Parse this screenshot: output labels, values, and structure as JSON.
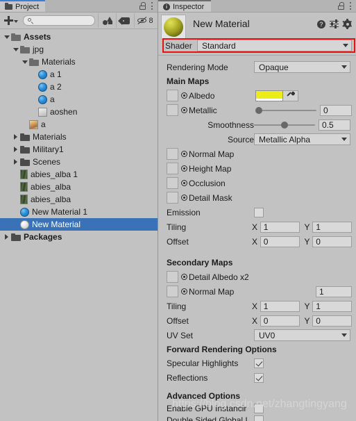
{
  "project": {
    "tab_label": "Project",
    "tab_icon": "folder-icon",
    "lock_icon": "lock-icon",
    "menu_icon": "kebab-menu-icon",
    "toolbar": {
      "add_label": "+",
      "add_icon": "plus-icon",
      "add_caret_icon": "caret-down-icon",
      "search_value": "",
      "search_placeholder": "",
      "search_icon": "search-icon",
      "filter_icon": "shape-filter-icon",
      "tag_icon": "label-tag-icon",
      "visibility_icon": "eye-slash-icon",
      "hidden_count": "8"
    },
    "tree": [
      {
        "label": "Assets",
        "depth": 0,
        "arrow": "down",
        "icon": "folder-open-icon",
        "bold": true,
        "selected": false
      },
      {
        "label": "jpg",
        "depth": 1,
        "arrow": "down",
        "icon": "folder-open-icon",
        "bold": false,
        "selected": false
      },
      {
        "label": "Materials",
        "depth": 2,
        "arrow": "down",
        "icon": "folder-open-icon",
        "bold": false,
        "selected": false
      },
      {
        "label": "a 1",
        "depth": 3,
        "arrow": "none",
        "icon": "material-icon",
        "bold": false,
        "selected": false
      },
      {
        "label": "a 2",
        "depth": 3,
        "arrow": "none",
        "icon": "material-icon",
        "bold": false,
        "selected": false
      },
      {
        "label": "a",
        "depth": 3,
        "arrow": "none",
        "icon": "material-icon",
        "bold": false,
        "selected": false
      },
      {
        "label": "aoshen",
        "depth": 3,
        "arrow": "none",
        "icon": "image-grey-icon",
        "bold": false,
        "selected": false
      },
      {
        "label": "a",
        "depth": 2,
        "arrow": "none",
        "icon": "image-icon",
        "bold": false,
        "selected": false
      },
      {
        "label": "Materials",
        "depth": 1,
        "arrow": "right",
        "icon": "folder-icon",
        "bold": false,
        "selected": false
      },
      {
        "label": "Military1",
        "depth": 1,
        "arrow": "right",
        "icon": "folder-icon",
        "bold": false,
        "selected": false
      },
      {
        "label": "Scenes",
        "depth": 1,
        "arrow": "right",
        "icon": "folder-icon",
        "bold": false,
        "selected": false
      },
      {
        "label": "abies_alba 1",
        "depth": 1,
        "arrow": "none",
        "icon": "tree-asset-icon",
        "bold": false,
        "selected": false
      },
      {
        "label": "abies_alba",
        "depth": 1,
        "arrow": "none",
        "icon": "tree-asset-icon",
        "bold": false,
        "selected": false
      },
      {
        "label": "abies_alba",
        "depth": 1,
        "arrow": "none",
        "icon": "tree-asset-icon",
        "bold": false,
        "selected": false
      },
      {
        "label": "New Material 1",
        "depth": 1,
        "arrow": "none",
        "icon": "material-icon",
        "bold": false,
        "selected": false
      },
      {
        "label": "New Material",
        "depth": 1,
        "arrow": "none",
        "icon": "material-white-icon",
        "bold": false,
        "selected": true
      },
      {
        "label": "Packages",
        "depth": 0,
        "arrow": "right",
        "icon": "folder-icon",
        "bold": true,
        "selected": false
      }
    ]
  },
  "inspector": {
    "tab_label": "Inspector",
    "tab_icon": "info-icon",
    "lock_icon": "lock-icon",
    "menu_icon": "kebab-menu-icon",
    "material_name": "New Material",
    "preview_icon": "material-sphere-preview",
    "help_icon": "help-icon",
    "preset_icon": "preset-sliders-icon",
    "settings_icon": "gear-icon",
    "shader": {
      "label": "Shader",
      "value": "Standard",
      "caret_icon": "caret-down-icon",
      "highlight_color": "#e81010"
    },
    "rendering_mode": {
      "label": "Rendering Mode",
      "value": "Opaque",
      "caret_icon": "caret-down-icon"
    },
    "main_maps": {
      "header": "Main Maps",
      "albedo": {
        "label": "Albedo",
        "color": "#ecec18",
        "eyedropper_icon": "eyedropper-icon",
        "slot_icon": "texture-slot-icon",
        "radio_icon": "radio-dot-icon"
      },
      "metallic": {
        "label": "Metallic",
        "value": "0",
        "slider_pct": 0
      },
      "smoothness": {
        "label": "Smoothness",
        "value": "0.5",
        "slider_pct": 50
      },
      "source": {
        "label": "Source",
        "value": "Metallic Alpha",
        "caret_icon": "caret-down-icon"
      },
      "texture_slots": [
        {
          "label": "Normal Map"
        },
        {
          "label": "Height Map"
        },
        {
          "label": "Occlusion"
        },
        {
          "label": "Detail Mask"
        }
      ],
      "emission": {
        "label": "Emission",
        "checked": false
      },
      "tiling": {
        "label": "Tiling",
        "x_label": "X",
        "x": "1",
        "y_label": "Y",
        "y": "1"
      },
      "offset": {
        "label": "Offset",
        "x_label": "X",
        "x": "0",
        "y_label": "Y",
        "y": "0"
      }
    },
    "secondary_maps": {
      "header": "Secondary Maps",
      "detail_albedo": {
        "label": "Detail Albedo x2"
      },
      "normal_map": {
        "label": "Normal Map",
        "value": "1"
      },
      "tiling": {
        "label": "Tiling",
        "x_label": "X",
        "x": "1",
        "y_label": "Y",
        "y": "1"
      },
      "offset": {
        "label": "Offset",
        "x_label": "X",
        "x": "0",
        "y_label": "Y",
        "y": "0"
      },
      "uv_set": {
        "label": "UV Set",
        "value": "UV0",
        "caret_icon": "caret-down-icon"
      }
    },
    "forward_rendering": {
      "header": "Forward Rendering Options",
      "specular_highlights": {
        "label": "Specular Highlights",
        "checked": true
      },
      "reflections": {
        "label": "Reflections",
        "checked": true
      }
    },
    "advanced": {
      "header": "Advanced Options",
      "gpu_instancing": {
        "label": "Enable GPU Instancir",
        "checked": false
      },
      "double_sided": {
        "label": "Double Sided Global I",
        "checked": false
      }
    }
  },
  "watermark": "https://blog.csdn.net/zhangtingyang"
}
